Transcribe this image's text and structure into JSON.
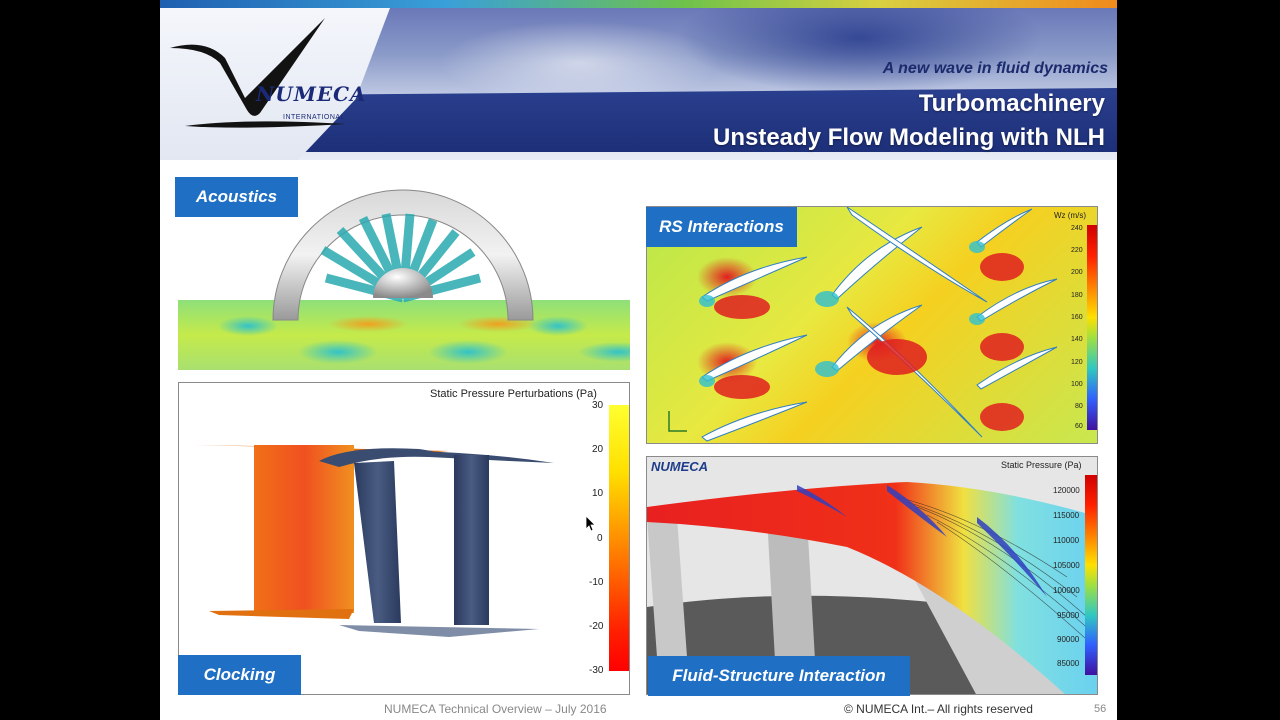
{
  "header": {
    "tagline": "A new wave in fluid dynamics",
    "title_line1": "Turbomachinery",
    "title_line2": "Unsteady Flow Modeling with NLH",
    "logo_name": "NUMECA",
    "logo_sub": "INTERNATIONAL"
  },
  "panels": {
    "acoustics": {
      "label": "Acoustics"
    },
    "clocking": {
      "label": "Clocking",
      "colorbar_title": "Static Pressure Perturbations (Pa)",
      "ticks": [
        "30",
        "20",
        "10",
        "0",
        "-10",
        "-20",
        "-30"
      ]
    },
    "rs": {
      "label": "RS Interactions",
      "colorbar_title": "Wz (m/s)",
      "ticks": [
        "240",
        "220",
        "200",
        "180",
        "160",
        "140",
        "120",
        "100",
        "80",
        "60"
      ]
    },
    "fsi": {
      "label": "Fluid-Structure Interaction",
      "brand": "NUMECA",
      "colorbar_title": "Static Pressure (Pa)",
      "ticks": [
        "120000",
        "115000",
        "110000",
        "105000",
        "100000",
        "95000",
        "90000",
        "85000"
      ]
    }
  },
  "footer": {
    "center": "NUMECA Technical Overview – July 2016",
    "right": "© NUMECA Int.– All rights reserved",
    "page": "56"
  },
  "colors": {
    "label_blue": "#1f6fc4",
    "header_blue": "#1d2f78"
  }
}
